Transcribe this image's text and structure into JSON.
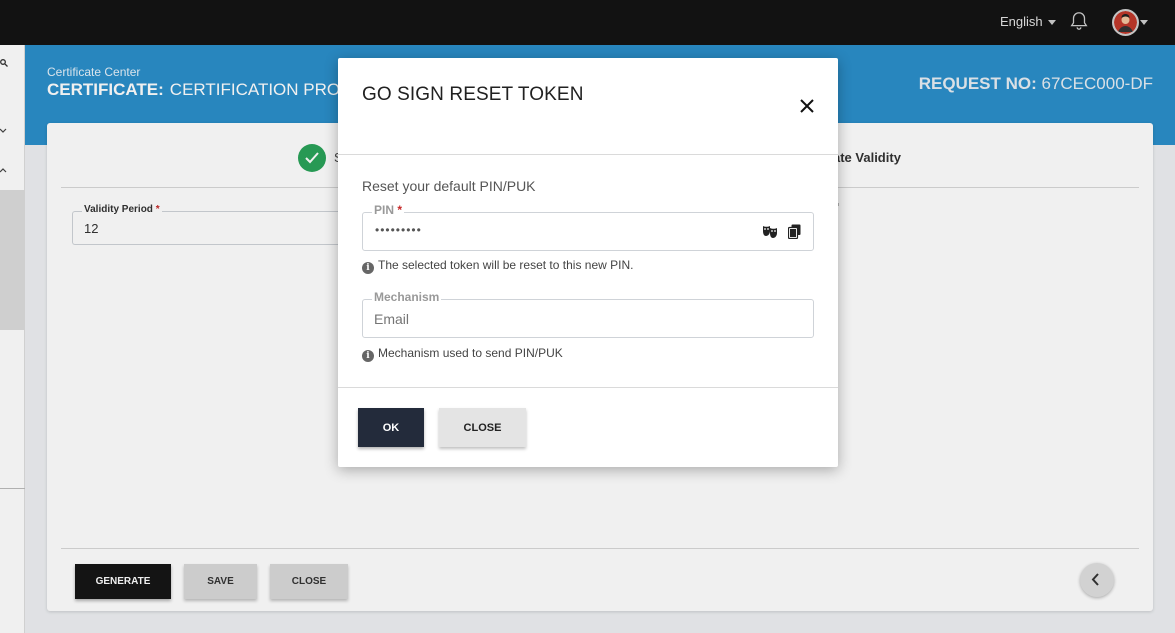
{
  "topbar": {
    "language": "English",
    "icons": [
      "bell-icon",
      "avatar",
      "chevron-down-icon"
    ]
  },
  "header": {
    "breadcrumb": "Certificate Center",
    "title_label": "CERTIFICATE:",
    "title_value": "CERTIFICATION PROF",
    "request_label": "REQUEST NO:",
    "request_value": "67CEC000-DF",
    "band_color": "#2b8fca"
  },
  "steps": {
    "left_label": "S",
    "right_label": "ate Validity",
    "done_color": "#2aa35a"
  },
  "form": {
    "validity_period_label": "Validity Period",
    "required_mark": "*",
    "validity_period_value": "12"
  },
  "footer": {
    "generate_label": "GENERATE",
    "save_label": "SAVE",
    "close_label": "CLOSE"
  },
  "modal": {
    "title": "GO SIGN RESET TOKEN",
    "subtitle": "Reset your default PIN/PUK",
    "pin": {
      "label": "PIN",
      "required_mark": "*",
      "value": "•••••••••",
      "hint": "The selected token will be reset to this new PIN."
    },
    "mechanism": {
      "label": "Mechanism",
      "placeholder": "Email",
      "hint": "Mechanism used to send PIN/PUK"
    },
    "ok_label": "OK",
    "close_label": "CLOSE",
    "ok_color": "#232b3b"
  }
}
